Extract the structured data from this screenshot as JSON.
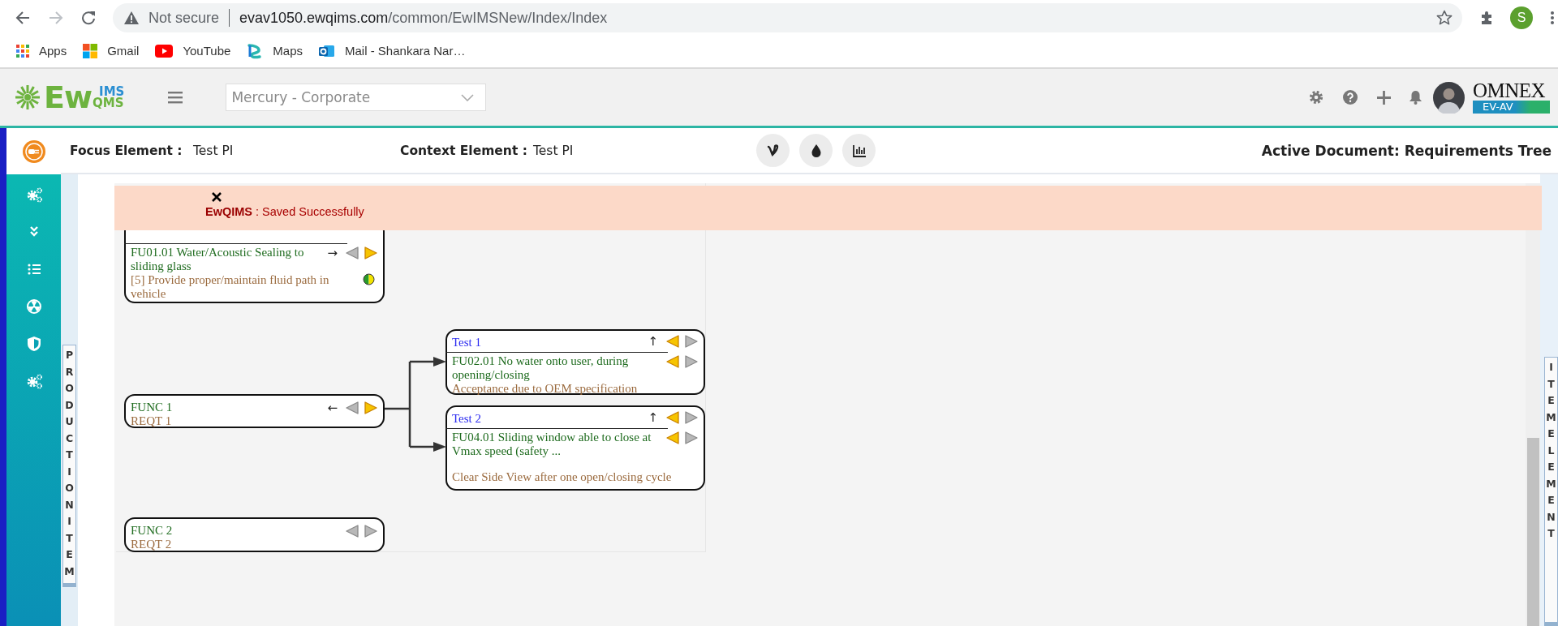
{
  "browser": {
    "security": "Not secure",
    "host": "evav1050.ewqims.com",
    "path": "/common/EwIMSNew/Index/Index",
    "profile_initial": "S",
    "bookmarks": [
      {
        "kind": "apps",
        "label": "Apps"
      },
      {
        "kind": "gmail",
        "label": "Gmail"
      },
      {
        "kind": "youtube",
        "label": "YouTube"
      },
      {
        "kind": "maps",
        "label": "Maps"
      },
      {
        "kind": "mail",
        "label": "Mail - Shankara Nar…"
      }
    ]
  },
  "app_header": {
    "logo": {
      "main": "Ew",
      "top": "IMS",
      "bottom": "QMS"
    },
    "site_select": {
      "value": "Mercury - Corporate"
    },
    "brand": {
      "name": "OMNEX",
      "tag": "EV-AV"
    }
  },
  "context_bar": {
    "focus": {
      "label": "Focus Element :",
      "value": "Test PI"
    },
    "context": {
      "label": "Context Element :",
      "value": "Test PI"
    },
    "active_document": "Active Document: Requirements Tree"
  },
  "toast": {
    "message": "**EwQIMS** : Saved Successfully"
  },
  "side_tabs": {
    "left": "PRODUCTION ITEM",
    "right": "ITEM ELEMENT"
  },
  "tree": {
    "left_nodes": [
      {
        "kind": "detail",
        "item": {
          "text": "FU01.01 Water/Acoustic Sealing to sliding glass",
          "arrow": "→",
          "prev_active": false,
          "next_active": true
        },
        "note": "[5] Provide proper/maintain fluid path in vehicle",
        "complete": false
      },
      {
        "kind": "function",
        "name": "FUNC 1",
        "requirement": "REQT 1",
        "arrow": "←",
        "prev_active": false,
        "next_active": true
      },
      {
        "kind": "function",
        "name": "FUNC 2",
        "requirement": "REQT 2",
        "prev_active": false,
        "next_active": false
      }
    ],
    "right_nodes": [
      {
        "kind": "detail",
        "title": "Test 1",
        "arrow": "↑",
        "prev_active": true,
        "next_active": false,
        "item": {
          "text": "FU02.01 No water onto user, during opening/closing",
          "prev_active": true,
          "next_active": false
        },
        "note": "Acceptance due to OEM specification"
      },
      {
        "kind": "detail",
        "title": "Test 2",
        "arrow": "↑",
        "prev_active": true,
        "next_active": false,
        "item": {
          "text": "FU04.01 Sliding window able to close at Vmax speed (safety ...",
          "prev_active": true,
          "next_active": false
        },
        "note": "Clear Side View after one open/closing cycle"
      }
    ]
  }
}
